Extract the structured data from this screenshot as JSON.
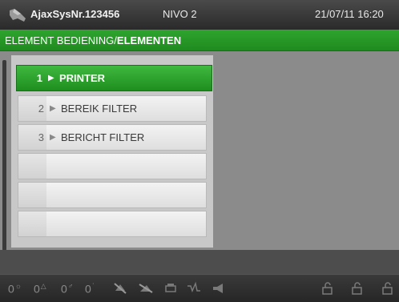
{
  "header": {
    "system_name": "AjaxSysNr.123456",
    "level": "NIVO 2",
    "datetime": "21/07/11 16:20"
  },
  "breadcrumb": {
    "part1": "ELEMENT BEDIENING/",
    "part2": "ELEMENTEN"
  },
  "menu": {
    "items": [
      {
        "number": "1",
        "arrow": "▶",
        "label": "PRINTER",
        "selected": true
      },
      {
        "number": "2",
        "arrow": "▶",
        "label": "BEREIK FILTER",
        "selected": false
      },
      {
        "number": "3",
        "arrow": "▶",
        "label": "BERICHT FILTER",
        "selected": false
      },
      {
        "number": "",
        "arrow": "",
        "label": "",
        "selected": false
      },
      {
        "number": "",
        "arrow": "",
        "label": "",
        "selected": false
      },
      {
        "number": "",
        "arrow": "",
        "label": "",
        "selected": false
      }
    ]
  },
  "status": {
    "counters": [
      {
        "value": "0",
        "icon": "sun-icon",
        "symbol": "☼"
      },
      {
        "value": "0",
        "icon": "warning-triangle-icon",
        "symbol": "△"
      },
      {
        "value": "0",
        "icon": "person-icon",
        "symbol": "♂"
      },
      {
        "value": "0",
        "icon": "fault-icon",
        "symbol": "ʾ"
      }
    ],
    "icons": [
      "bell-off-icon",
      "bell-slash-icon",
      "printer-icon",
      "relay-icon",
      "horn-icon",
      "lock-icon-1",
      "lock-icon-2",
      "lock-icon-3"
    ]
  },
  "colors": {
    "accent_green": "#2ea52e",
    "header_dark": "#2a2a2a"
  }
}
